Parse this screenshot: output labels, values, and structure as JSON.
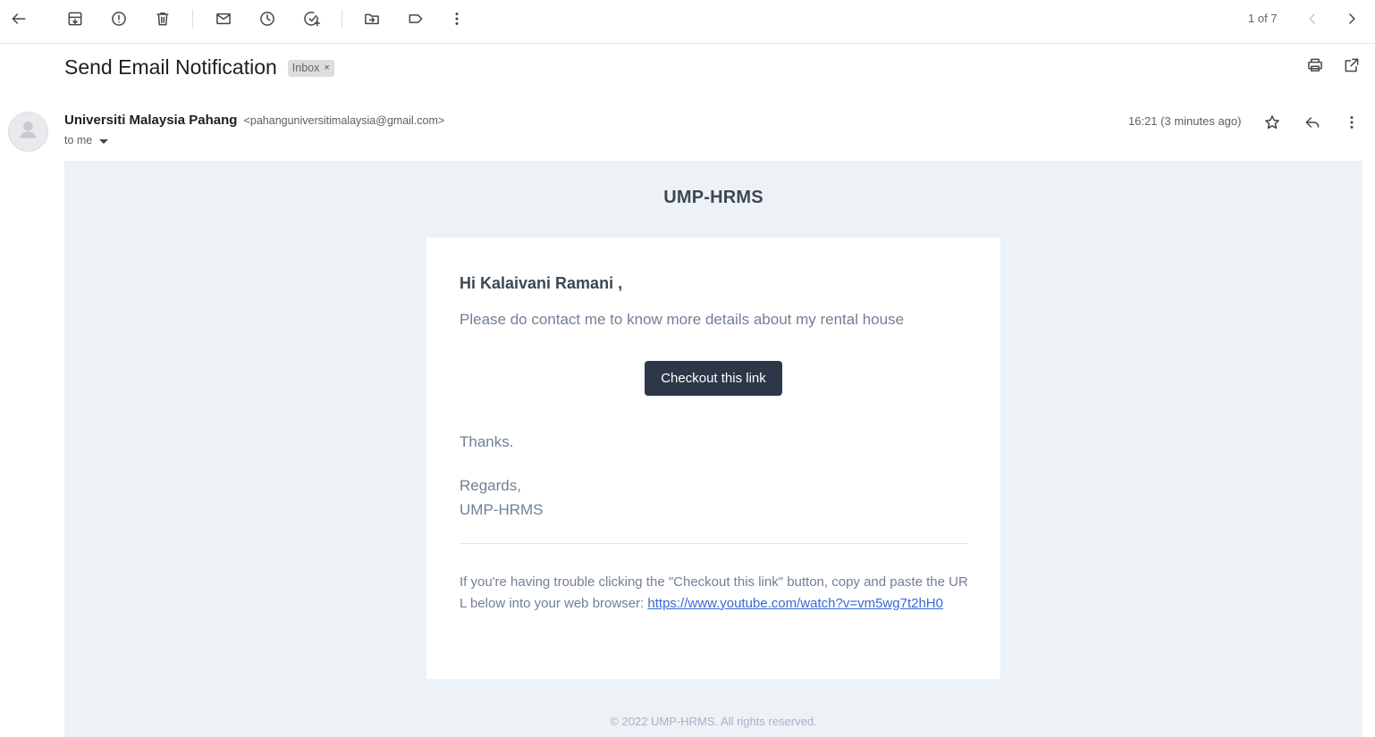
{
  "toolbar": {
    "icons": [
      "back-arrow-icon",
      "archive-icon",
      "report-spam-icon",
      "delete-icon",
      "mark-unread-icon",
      "snooze-icon",
      "add-to-tasks-icon",
      "move-to-icon",
      "labels-icon",
      "more-vert-icon"
    ],
    "pager": "1 of 7"
  },
  "email": {
    "subject": "Send Email Notification",
    "label": "Inbox",
    "label_remove": "×",
    "sender_name": "Universiti Malaysia Pahang",
    "sender_email": "<pahanguniversitimalaysia@gmail.com>",
    "recipient": "to me",
    "time": "16:21 (3 minutes ago)"
  },
  "body": {
    "brand": "UMP-HRMS",
    "greeting": "Hi Kalaivani Ramani ,",
    "intro": "Please do contact me to know more details about my rental house",
    "button_label": "Checkout this link",
    "thanks": "Thanks.",
    "regards": "Regards,",
    "signature": "UMP-HRMS",
    "subcopy": "If you're having trouble clicking the \"Checkout this link\" button, copy and paste the URL below into your web browser: ",
    "url": "https://www.youtube.com/watch?v=vm5wg7t2hH0",
    "footer": "© 2022 UMP-HRMS. All rights reserved."
  },
  "colors": {
    "email_background": "#edf2f7",
    "button": "#2d3748",
    "heading_text": "#3d4852",
    "body_text": "#718096",
    "link": "#3869d4"
  }
}
